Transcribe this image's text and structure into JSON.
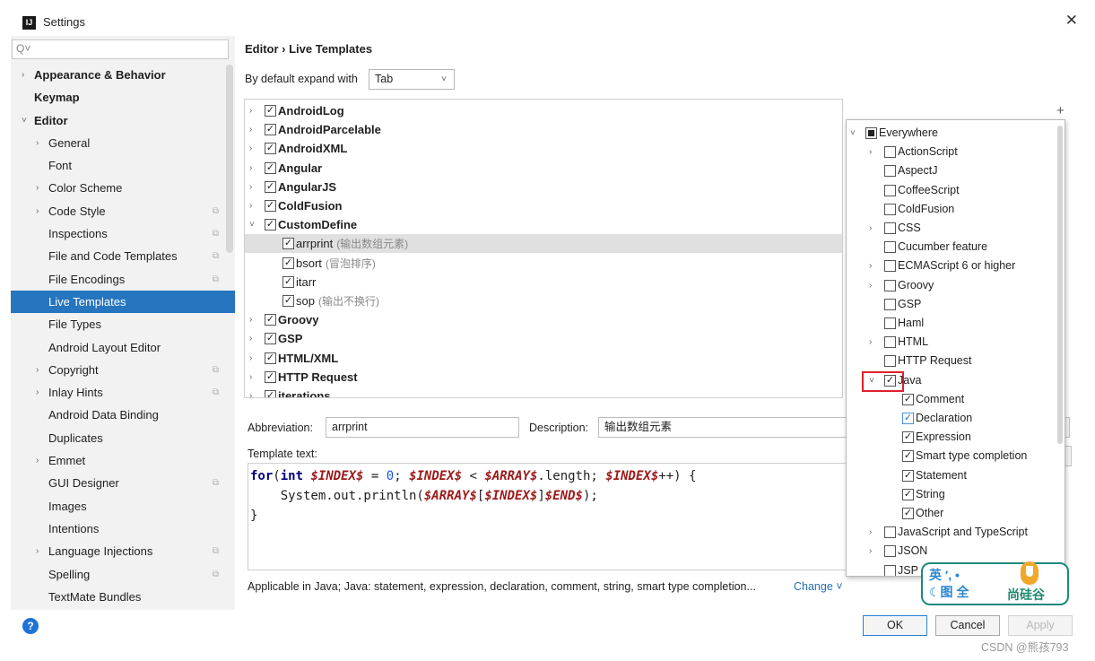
{
  "window": {
    "title": "Settings",
    "app_icon_text": "IJ",
    "close_glyph": "✕"
  },
  "sidebar": {
    "search_placeholder": "Q˅",
    "items": [
      {
        "label": "Appearance & Behavior",
        "bold": true,
        "arrow": "›",
        "indent": 0,
        "copy": false
      },
      {
        "label": "Keymap",
        "bold": true,
        "arrow": "",
        "indent": 0,
        "copy": false
      },
      {
        "label": "Editor",
        "bold": true,
        "arrow": "˅",
        "indent": 0,
        "copy": false
      },
      {
        "label": "General",
        "bold": false,
        "arrow": "›",
        "indent": 1,
        "copy": false
      },
      {
        "label": "Font",
        "bold": false,
        "arrow": "",
        "indent": 2,
        "copy": false
      },
      {
        "label": "Color Scheme",
        "bold": false,
        "arrow": "›",
        "indent": 1,
        "copy": false
      },
      {
        "label": "Code Style",
        "bold": false,
        "arrow": "›",
        "indent": 1,
        "copy": true
      },
      {
        "label": "Inspections",
        "bold": false,
        "arrow": "",
        "indent": 2,
        "copy": true
      },
      {
        "label": "File and Code Templates",
        "bold": false,
        "arrow": "",
        "indent": 2,
        "copy": true
      },
      {
        "label": "File Encodings",
        "bold": false,
        "arrow": "",
        "indent": 2,
        "copy": true
      },
      {
        "label": "Live Templates",
        "bold": false,
        "arrow": "",
        "indent": 2,
        "copy": false,
        "selected": true
      },
      {
        "label": "File Types",
        "bold": false,
        "arrow": "",
        "indent": 2,
        "copy": false
      },
      {
        "label": "Android Layout Editor",
        "bold": false,
        "arrow": "",
        "indent": 2,
        "copy": false
      },
      {
        "label": "Copyright",
        "bold": false,
        "arrow": "›",
        "indent": 1,
        "copy": true
      },
      {
        "label": "Inlay Hints",
        "bold": false,
        "arrow": "›",
        "indent": 1,
        "copy": true
      },
      {
        "label": "Android Data Binding",
        "bold": false,
        "arrow": "",
        "indent": 2,
        "copy": false
      },
      {
        "label": "Duplicates",
        "bold": false,
        "arrow": "",
        "indent": 2,
        "copy": false
      },
      {
        "label": "Emmet",
        "bold": false,
        "arrow": "›",
        "indent": 1,
        "copy": false
      },
      {
        "label": "GUI Designer",
        "bold": false,
        "arrow": "",
        "indent": 2,
        "copy": true
      },
      {
        "label": "Images",
        "bold": false,
        "arrow": "",
        "indent": 2,
        "copy": false
      },
      {
        "label": "Intentions",
        "bold": false,
        "arrow": "",
        "indent": 2,
        "copy": false
      },
      {
        "label": "Language Injections",
        "bold": false,
        "arrow": "›",
        "indent": 1,
        "copy": true
      },
      {
        "label": "Spelling",
        "bold": false,
        "arrow": "",
        "indent": 2,
        "copy": true
      },
      {
        "label": "TextMate Bundles",
        "bold": false,
        "arrow": "",
        "indent": 2,
        "copy": false
      }
    ],
    "help_glyph": "?"
  },
  "main": {
    "breadcrumb": "Editor  ›  Live Templates",
    "expand_label": "By default expand with",
    "expand_value": "Tab",
    "expand_chevron": "˅",
    "templates": [
      {
        "name": "AndroidLog",
        "type": "group",
        "arrow": "›",
        "checked": true
      },
      {
        "name": "AndroidParcelable",
        "type": "group",
        "arrow": "›",
        "checked": true
      },
      {
        "name": "AndroidXML",
        "type": "group",
        "arrow": "›",
        "checked": true
      },
      {
        "name": "Angular",
        "type": "group",
        "arrow": "›",
        "checked": true
      },
      {
        "name": "AngularJS",
        "type": "group",
        "arrow": "›",
        "checked": true
      },
      {
        "name": "ColdFusion",
        "type": "group",
        "arrow": "›",
        "checked": true
      },
      {
        "name": "CustomDefine",
        "type": "group",
        "arrow": "˅",
        "checked": true
      },
      {
        "name": "arrprint",
        "desc": "(输出数组元素)",
        "type": "item",
        "checked": true,
        "selected": true
      },
      {
        "name": "bsort",
        "desc": "(冒泡排序)",
        "type": "item",
        "checked": true
      },
      {
        "name": "itarr",
        "desc": "",
        "type": "item",
        "checked": true
      },
      {
        "name": "sop",
        "desc": "(输出不换行)",
        "type": "item",
        "checked": true
      },
      {
        "name": "Groovy",
        "type": "group",
        "arrow": "›",
        "checked": true
      },
      {
        "name": "GSP",
        "type": "group",
        "arrow": "›",
        "checked": true
      },
      {
        "name": "HTML/XML",
        "type": "group",
        "arrow": "›",
        "checked": true
      },
      {
        "name": "HTTP Request",
        "type": "group",
        "arrow": "›",
        "checked": true
      },
      {
        "name": "iterations",
        "type": "group",
        "arrow": "›",
        "checked": true
      }
    ],
    "toolbar_add": "+",
    "abbreviation_label": "Abbreviation:",
    "abbreviation_value": "arrprint",
    "description_label": "Description:",
    "description_value": "输出数组元素",
    "template_text_label": "Template text:",
    "code": {
      "l1_kw1": "for",
      "l1_p1": "(",
      "l1_kw2": "int",
      "l1_v1": "$INDEX$",
      "l1_p2": " = ",
      "l1_n1": "0",
      "l1_p3": "; ",
      "l1_v2": "$INDEX$",
      "l1_p4": " < ",
      "l1_v3": "$ARRAY$",
      "l1_p5": ".length; ",
      "l1_v4": "$INDEX$",
      "l1_p6": "++) {",
      "l2_p1": "    System.out.println(",
      "l2_v1": "$ARRAY$",
      "l2_p2": "[",
      "l2_v2": "$INDEX$",
      "l2_p3": "]",
      "l2_v3": "$END$",
      "l2_p4": ");",
      "l3": "}"
    },
    "applicable_text": "Applicable in Java; Java: statement, expression, declaration, comment, string, smart type completion...",
    "change_link": "Change ˅"
  },
  "context_popup": {
    "items": [
      {
        "label": "Everywhere",
        "arrow": "˅",
        "state": "partial",
        "indent": 0
      },
      {
        "label": "ActionScript",
        "arrow": "›",
        "state": "off",
        "indent": 1
      },
      {
        "label": "AspectJ",
        "arrow": "",
        "state": "off",
        "indent": 1
      },
      {
        "label": "CoffeeScript",
        "arrow": "",
        "state": "off",
        "indent": 1
      },
      {
        "label": "ColdFusion",
        "arrow": "",
        "state": "off",
        "indent": 1
      },
      {
        "label": "CSS",
        "arrow": "›",
        "state": "off",
        "indent": 1
      },
      {
        "label": "Cucumber feature",
        "arrow": "",
        "state": "off",
        "indent": 1
      },
      {
        "label": "ECMAScript 6 or higher",
        "arrow": "›",
        "state": "off",
        "indent": 1
      },
      {
        "label": "Groovy",
        "arrow": "›",
        "state": "off",
        "indent": 1
      },
      {
        "label": "GSP",
        "arrow": "",
        "state": "off",
        "indent": 1
      },
      {
        "label": "Haml",
        "arrow": "",
        "state": "off",
        "indent": 1
      },
      {
        "label": "HTML",
        "arrow": "›",
        "state": "off",
        "indent": 1
      },
      {
        "label": "HTTP Request",
        "arrow": "",
        "state": "off",
        "indent": 1
      },
      {
        "label": "Java",
        "arrow": "˅",
        "state": "on",
        "indent": 1
      },
      {
        "label": "Comment",
        "arrow": "",
        "state": "on",
        "indent": 2
      },
      {
        "label": "Declaration",
        "arrow": "",
        "state": "on-blue",
        "indent": 2
      },
      {
        "label": "Expression",
        "arrow": "",
        "state": "on",
        "indent": 2
      },
      {
        "label": "Smart type completion",
        "arrow": "",
        "state": "on",
        "indent": 2
      },
      {
        "label": "Statement",
        "arrow": "",
        "state": "on",
        "indent": 2
      },
      {
        "label": "String",
        "arrow": "",
        "state": "on",
        "indent": 2
      },
      {
        "label": "Other",
        "arrow": "",
        "state": "on",
        "indent": 2
      },
      {
        "label": "JavaScript and TypeScript",
        "arrow": "›",
        "state": "off",
        "indent": 1
      },
      {
        "label": "JSON",
        "arrow": "›",
        "state": "off",
        "indent": 1
      },
      {
        "label": "JSP",
        "arrow": "",
        "state": "off",
        "indent": 1
      }
    ]
  },
  "buttons": {
    "ok": "OK",
    "cancel": "Cancel",
    "apply": "Apply"
  },
  "watermark": {
    "csdn": "CSDN @熊孩793",
    "logo_left_line1": "英 ′, •",
    "logo_left_line2": "☾图 全",
    "logo_right": "尚硅谷"
  },
  "colors": {
    "selection": "#2675bf",
    "accent_link": "#2470b3",
    "highlight_box": "#e0202a",
    "template_var": "#9c1a1a",
    "keyword": "#000080"
  }
}
